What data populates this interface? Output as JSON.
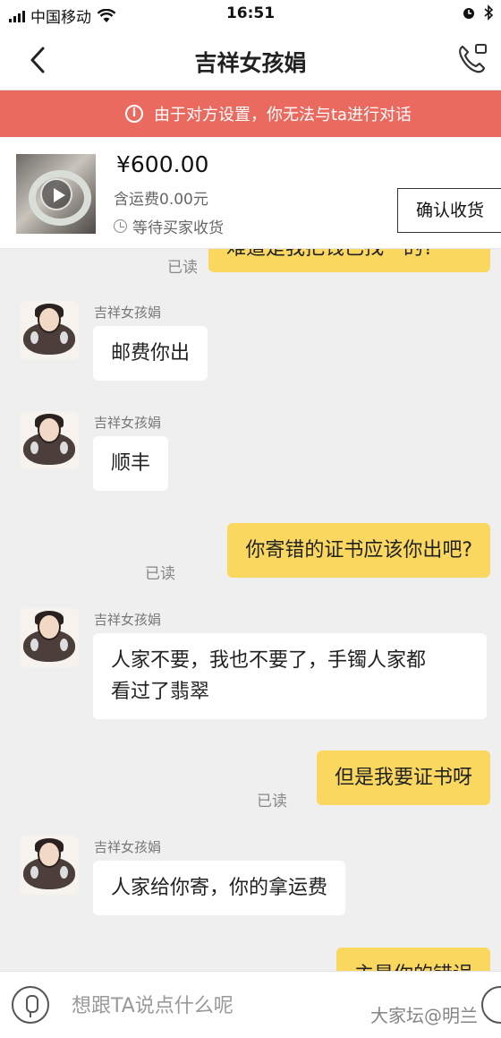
{
  "status_bar": {
    "carrier": "中国移动",
    "time": "16:51"
  },
  "header": {
    "title": "吉祥女孩娟"
  },
  "banner": {
    "text": "由于对方设置，你无法与ta进行对话"
  },
  "product": {
    "price": "¥600.00",
    "shipping": "含运费0.00元",
    "status": "等待买家收货",
    "confirm_label": "确认收货"
  },
  "chat": {
    "top_partial_text": "难道是我把钱已找一的?",
    "messages": [
      {
        "sender": "吉祥女孩娟",
        "text": "邮费你出"
      },
      {
        "sender": "吉祥女孩娟",
        "text": "顺丰"
      },
      {
        "text": "你寄错的证书应该你出吧?",
        "read": "已读"
      },
      {
        "sender": "吉祥女孩娟",
        "text_line1": "人家不要，我也不要了，手镯人家都",
        "text_line2": "看过了翡翠"
      },
      {
        "text": "但是我要证书呀",
        "read": "已读"
      },
      {
        "sender": "吉祥女孩娟",
        "text": "人家给你寄，你的拿运费"
      },
      {
        "text": "主是你的错误"
      }
    ],
    "read_label": "已读"
  },
  "input": {
    "placeholder": "想跟TA说点什么呢"
  },
  "watermark": "大家坛@明兰"
}
